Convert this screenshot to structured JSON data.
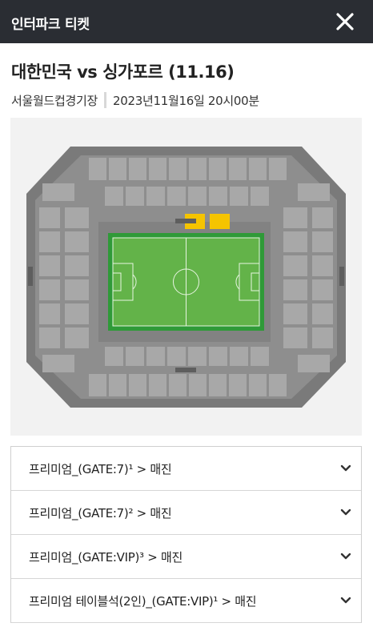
{
  "header": {
    "app_title": "인터파크 티켓",
    "close_icon": "close-icon"
  },
  "event": {
    "title": "대한민국 vs 싱가포르 (11.16)",
    "venue": "서울월드컵경기장",
    "datetime": "2023년11월16일 20시00분"
  },
  "seat_map": {
    "colors": {
      "available": "#f5c400",
      "stand": "#7a7a7a",
      "block": "#a8a8a8",
      "pitch": "#63b349",
      "pitch_border": "#2f9a38"
    }
  },
  "sections": [
    {
      "label": "프리미엄_(GATE:7)¹ > 매진",
      "icon": "chevron-down-icon"
    },
    {
      "label": "프리미엄_(GATE:7)² > 매진",
      "icon": "chevron-down-icon"
    },
    {
      "label": "프리미엄_(GATE:VIP)³ > 매진",
      "icon": "chevron-down-icon"
    },
    {
      "label": "프리미엄 테이블석(2인)_(GATE:VIP)¹ > 매진",
      "icon": "chevron-down-icon"
    }
  ]
}
